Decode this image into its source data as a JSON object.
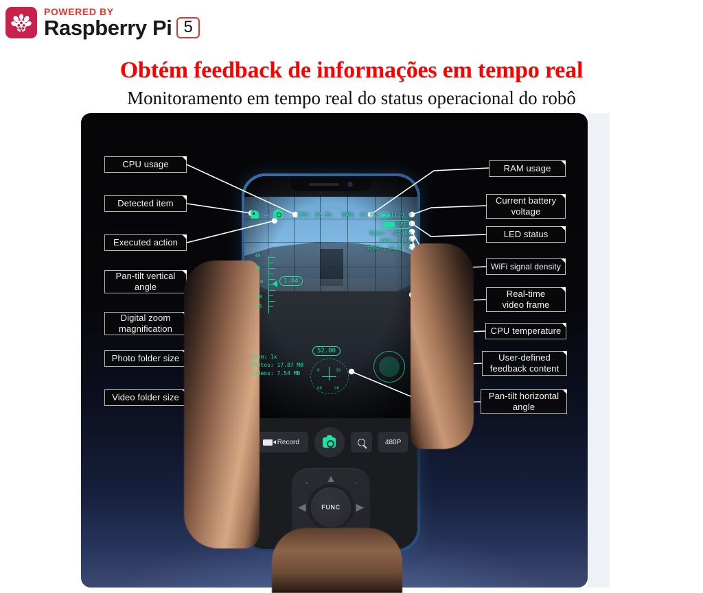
{
  "branding": {
    "powered_by": "POWERED BY",
    "product": "Raspberry Pi",
    "version": "5",
    "logo_icon": "raspberry-pi-icon",
    "brand_red": "#E8332A",
    "logo_bg": "#C7224B"
  },
  "headings": {
    "title": "Obtém feedback de informações em tempo real",
    "subtitle": "Monitoramento em tempo real do status operacional do robô",
    "title_color": "#FF0000"
  },
  "callouts": {
    "left": [
      {
        "label": "CPU usage"
      },
      {
        "label": "Detected item"
      },
      {
        "label": "Executed action"
      },
      {
        "label": "Pan-tilt vertical\nangle"
      },
      {
        "label": "Digital zoom\nmagnification"
      },
      {
        "label": "Photo folder size"
      },
      {
        "label": "Video folder size"
      }
    ],
    "right": [
      {
        "label": "RAM usage"
      },
      {
        "label": "Current battery\nvoltage"
      },
      {
        "label": "LED status"
      },
      {
        "label": "WiFi signal density"
      },
      {
        "label": "Real-time\nvideo frame"
      },
      {
        "label": "CPU temperature"
      },
      {
        "label": "User-defined\nfeedback content"
      },
      {
        "label": "Pan-tilt horizontal\nangle"
      }
    ]
  },
  "phone": {
    "hud": {
      "accent_color": "#18E3A0",
      "detected_item_icon": "tag-icon",
      "arrow_icon": "arrow-right-icon",
      "executed_action_icon": "camera-icon",
      "cpu": "CPU: 22.3%",
      "ram": "RAM: 14.5%",
      "battery_icon": "battery-icon",
      "voltage": "11.9 V",
      "led_icon": "led-icon",
      "led_status": "OFF",
      "rssi": "RSSI: -42dBm",
      "fps": "FPS: 31.8",
      "temp": "TEMP: 38.4 °C",
      "vertical_angle": "1.04",
      "vertical_scale": [
        "45",
        "30",
        "0",
        "-30",
        "-45"
      ],
      "horizontal_angle": "52.80",
      "compass_marks": [
        "0",
        "30",
        "60",
        "90"
      ],
      "zoom": "Zoom: 1x",
      "photos": "Photos: 17.87 MB",
      "videos": "Videos: 7.54 MB"
    },
    "controls": {
      "record_icon": "video-camera-icon",
      "record_label": "Record",
      "shutter_icon": "camera-icon",
      "zoom_icon": "magnifier-icon",
      "resolution_label": "480P",
      "dpad": {
        "up_icon": "chevron-up-icon",
        "down_icon": "chevron-down-icon",
        "left_icon": "chevron-left-icon",
        "right_icon": "chevron-right-icon",
        "center_label": "FUNC"
      }
    }
  }
}
